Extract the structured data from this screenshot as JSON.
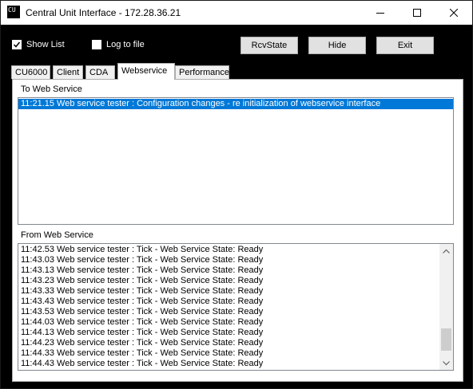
{
  "window": {
    "title": "Central Unit Interface - 172.28.36.21",
    "icon_text": "CU",
    "icon": "app-icon"
  },
  "titlebar_buttons": {
    "minimize": "minimize-icon",
    "maximize": "maximize-icon",
    "close": "close-icon"
  },
  "options": {
    "show_list": {
      "label": "Show List",
      "checked": true
    },
    "log_to_file": {
      "label": "Log to file",
      "checked": false
    }
  },
  "buttons": {
    "rcvstate": "RcvState",
    "hide": "Hide",
    "exit": "Exit"
  },
  "tabs": [
    {
      "label": "CU6000",
      "active": false
    },
    {
      "label": "Client",
      "active": false
    },
    {
      "label": "CDA",
      "active": false
    },
    {
      "label": "Webservice",
      "active": true
    },
    {
      "label": "Performance",
      "active": false
    }
  ],
  "to_web_service": {
    "label": "To Web Service",
    "items": [
      {
        "text": "11:21.15 Web service tester : Configuration changes - re initialization of webservice interface",
        "selected": true
      }
    ]
  },
  "from_web_service": {
    "label": "From Web Service",
    "scroll_position": 0.93,
    "items": [
      "11:42.53 Web service tester : Tick - Web Service State: Ready",
      "11:43.03 Web service tester : Tick - Web Service State: Ready",
      "11:43.13 Web service tester : Tick - Web Service State: Ready",
      "11:43.23 Web service tester : Tick - Web Service State: Ready",
      "11:43.33 Web service tester : Tick - Web Service State: Ready",
      "11:43.43 Web service tester : Tick - Web Service State: Ready",
      "11:43.53 Web service tester : Tick - Web Service State: Ready",
      "11:44.03 Web service tester : Tick - Web Service State: Ready",
      "11:44.13 Web service tester : Tick - Web Service State: Ready",
      "11:44.23 Web service tester : Tick - Web Service State: Ready",
      "11:44.33 Web service tester : Tick - Web Service State: Ready",
      "11:44.43 Web service tester : Tick - Web Service State: Ready"
    ]
  },
  "colors": {
    "selection": "#0078d7",
    "window_background": "#000000",
    "panel_background": "#ffffff"
  }
}
